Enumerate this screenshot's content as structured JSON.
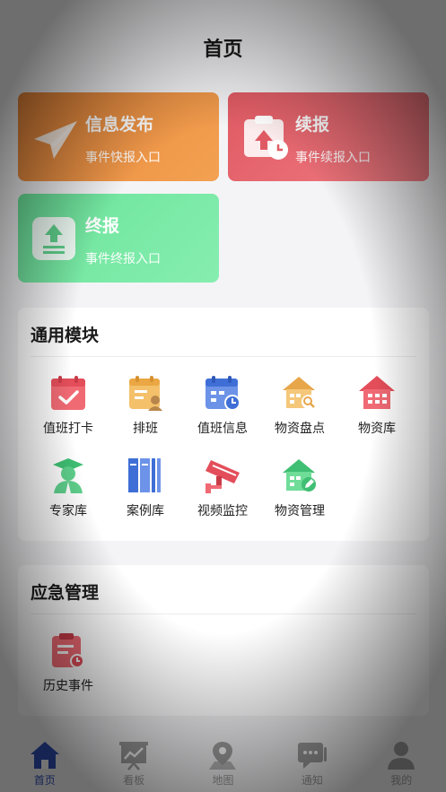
{
  "header": {
    "title": "首页"
  },
  "quick_cards": [
    {
      "title": "信息发布",
      "subtitle": "事件快报入口",
      "icon": "paper-plane-icon",
      "color": "#ee8f40"
    },
    {
      "title": "续报",
      "subtitle": "事件续报入口",
      "icon": "clipboard-upload-icon",
      "color": "#e8636b"
    },
    {
      "title": "终报",
      "subtitle": "事件终报入口",
      "icon": "upload-doc-icon",
      "color": "#78e8a4"
    }
  ],
  "general": {
    "title": "通用模块",
    "items": [
      {
        "label": "值班打卡",
        "icon": "calendar-check-icon"
      },
      {
        "label": "排班",
        "icon": "schedule-icon"
      },
      {
        "label": "值班信息",
        "icon": "calendar-clock-icon"
      },
      {
        "label": "物资盘点",
        "icon": "warehouse-search-icon"
      },
      {
        "label": "物资库",
        "icon": "warehouse-icon"
      },
      {
        "label": "专家库",
        "icon": "expert-icon"
      },
      {
        "label": "案例库",
        "icon": "books-icon"
      },
      {
        "label": "视频监控",
        "icon": "cctv-camera-icon"
      },
      {
        "label": "物资管理",
        "icon": "warehouse-edit-icon"
      }
    ]
  },
  "emergency": {
    "title": "应急管理",
    "items": [
      {
        "label": "历史事件",
        "icon": "history-clipboard-icon"
      }
    ]
  },
  "tabbar": {
    "active": 0,
    "items": [
      {
        "label": "首页",
        "icon": "home-icon"
      },
      {
        "label": "看板",
        "icon": "dashboard-icon"
      },
      {
        "label": "地图",
        "icon": "map-pin-icon"
      },
      {
        "label": "通知",
        "icon": "message-icon"
      },
      {
        "label": "我的",
        "icon": "user-icon"
      }
    ]
  }
}
